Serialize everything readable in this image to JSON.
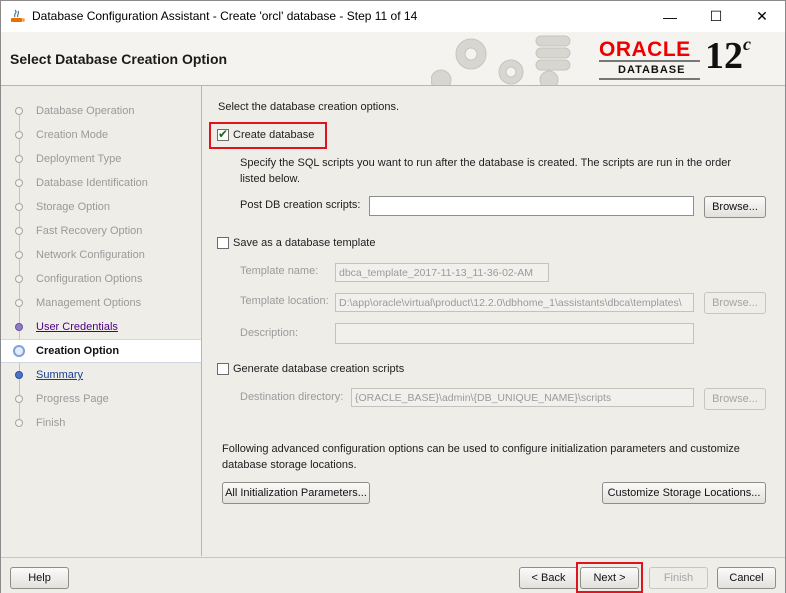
{
  "window": {
    "title": "Database Configuration Assistant - Create 'orcl' database - Step 11 of 14",
    "minimize": "—",
    "maximize": "☐",
    "close": "✕"
  },
  "header": {
    "page_title": "Select Database Creation Option",
    "logo_oracle": "ORACLE",
    "logo_database": "DATABASE",
    "logo_version": "12",
    "logo_version_suffix": "c"
  },
  "steps": [
    {
      "label": "Database Operation",
      "state": "disabled"
    },
    {
      "label": "Creation Mode",
      "state": "disabled"
    },
    {
      "label": "Deployment Type",
      "state": "disabled"
    },
    {
      "label": "Database Identification",
      "state": "disabled"
    },
    {
      "label": "Storage Option",
      "state": "disabled"
    },
    {
      "label": "Fast Recovery Option",
      "state": "disabled"
    },
    {
      "label": "Network Configuration",
      "state": "disabled"
    },
    {
      "label": "Configuration Options",
      "state": "disabled"
    },
    {
      "label": "Management Options",
      "state": "disabled"
    },
    {
      "label": "User Credentials",
      "state": "visited"
    },
    {
      "label": "Creation Option",
      "state": "current"
    },
    {
      "label": "Summary",
      "state": "next"
    },
    {
      "label": "Progress Page",
      "state": "disabled"
    },
    {
      "label": "Finish",
      "state": "disabled"
    }
  ],
  "main": {
    "intro": "Select the database creation options.",
    "create_db_label": "Create database",
    "create_db_checked": true,
    "create_db_desc_1": "Specify the SQL scripts you want to run after the database is created. The scripts are run in the order",
    "create_db_desc_2": "listed below.",
    "post_scripts_label": "Post DB creation scripts:",
    "post_scripts_value": "",
    "browse_label": "Browse...",
    "save_template_label": "Save as a database template",
    "save_template_checked": false,
    "template_name_label": "Template name:",
    "template_name_value": "dbca_template_2017-11-13_11-36-02-AM",
    "template_location_label": "Template location:",
    "template_location_value": "D:\\app\\oracle\\virtual\\product\\12.2.0\\dbhome_1\\assistants\\dbca\\templates\\",
    "description_label": "Description:",
    "description_value": "",
    "gen_scripts_label": "Generate database creation scripts",
    "gen_scripts_checked": false,
    "dest_dir_label": "Destination directory:",
    "dest_dir_value": "{ORACLE_BASE}\\admin\\{DB_UNIQUE_NAME}\\scripts",
    "advanced_text_1": "Following advanced configuration options can be used to configure initialization parameters and customize",
    "advanced_text_2": "database storage locations.",
    "all_init_params_label": "All Initialization Parameters...",
    "customize_storage_label": "Customize Storage Locations..."
  },
  "footer": {
    "help": "Help",
    "back": "< Back",
    "next": "Next >",
    "finish": "Finish",
    "cancel": "Cancel"
  },
  "colors": {
    "highlight": "#e0141e",
    "oracle_red": "#ee0000",
    "visited_step": "#4b0082",
    "next_step": "#1a3d8f"
  }
}
